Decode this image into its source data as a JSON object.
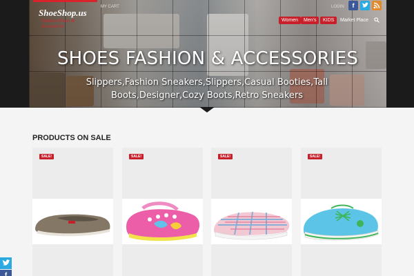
{
  "header": {
    "logo_main": "ShoeShop.us",
    "logo_sub": "Fashion Shoes & Accessories",
    "my_cart": "MY CART",
    "login": "LOGIN",
    "social_icons": [
      "facebook-icon",
      "twitter-icon",
      "rss-icon"
    ],
    "nav": [
      "Women",
      "Men's",
      "KIDS",
      "Market Place"
    ],
    "search_icon": "search-icon"
  },
  "hero": {
    "title": "SHOES FASHION & ACCESSORIES",
    "subtitle": "Slippers,Fashion Sneakers,Slippers,Casual Booties,Tall Boots,Designer,Cozy Boots,Retro Sneakers"
  },
  "products": {
    "section_title": "PRODUCTS ON SALE",
    "badge": "SALE!",
    "items": [
      {
        "image": "brown-canvas-slip-on"
      },
      {
        "image": "pink-butterfly-clog"
      },
      {
        "image": "plaid-slip-on-sneaker"
      },
      {
        "image": "blue-lace-up-sneaker"
      }
    ]
  },
  "sidebar": {
    "share": [
      "twitter-icon",
      "facebook-icon"
    ]
  },
  "colors": {
    "accent": "#c8202b",
    "facebook": "#3b5998",
    "twitter": "#2ba9e1",
    "rss": "#e28a2b"
  }
}
